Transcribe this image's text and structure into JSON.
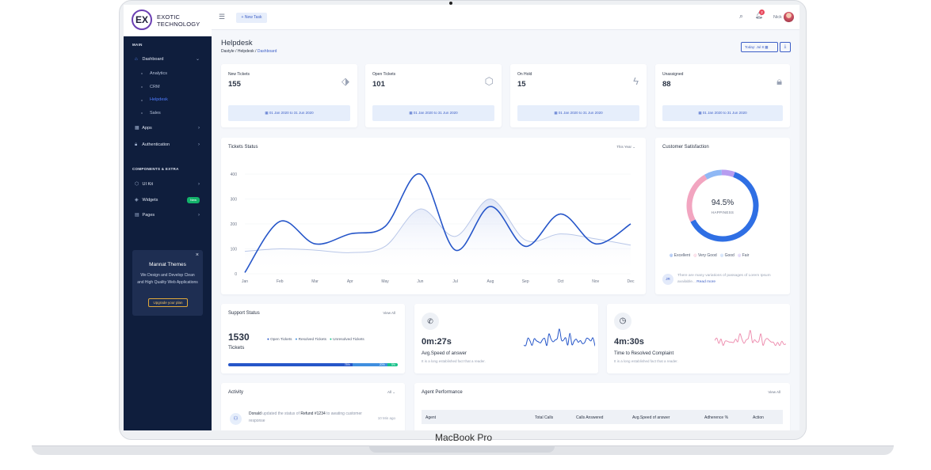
{
  "device": {
    "label": "MacBook Pro"
  },
  "brand": {
    "mark": "EX",
    "line1": "EXOTIC",
    "line2": "TECHNOLOGY"
  },
  "sidebar": {
    "main_heading": "MAIN",
    "dashboard": "Dashboard",
    "sub": [
      "Analytics",
      "CRM",
      "Helpdesk",
      "Sales"
    ],
    "apps": "Apps",
    "authentication": "Authentication",
    "components_heading": "COMPONENTS & EXTRA",
    "ui_kit": "UI Kit",
    "widgets": "Widgets",
    "widgets_badge": "New",
    "pages": "Pages",
    "promo": {
      "title": "Mannat Themes",
      "text": "We Design and Develop Clean and High Quality Web Applications",
      "button": "Upgrade your plan",
      "close": "×"
    }
  },
  "topbar": {
    "new_task": "+ New Task",
    "notification_count": "2",
    "user": "Nick"
  },
  "page": {
    "title": "Helpdesk",
    "breadcrumb": [
      "Dastyle",
      "Helpdesk",
      "Dashboard"
    ],
    "today": "Today: Jul 8"
  },
  "stats": [
    {
      "label": "New Tickets",
      "value": "155",
      "icon": "tag-icon",
      "range": "01 Jan 2020 to 31 Jun 2020"
    },
    {
      "label": "Open Tickets",
      "value": "101",
      "icon": "cube-icon",
      "range": "01 Jan 2020 to 31 Jun 2020"
    },
    {
      "label": "On Hold",
      "value": "15",
      "icon": "bolt-icon",
      "range": "01 Jan 2020 to 31 Jun 2020"
    },
    {
      "label": "Unassigned",
      "value": "88",
      "icon": "lock-icon",
      "range": "01 Jan 2020 to 31 Jun 2020"
    }
  ],
  "tickets_status": {
    "title": "Tickets Status",
    "period": "This Year"
  },
  "chart_data": {
    "type": "line",
    "categories": [
      "Jan",
      "Feb",
      "Mar",
      "Apr",
      "May",
      "Jun",
      "Jul",
      "Aug",
      "Sep",
      "Oct",
      "Nov",
      "Dec"
    ],
    "ylim": [
      0,
      400
    ],
    "yticks": [
      0,
      100,
      200,
      300,
      400
    ],
    "series": [
      {
        "values": [
          5,
          210,
          120,
          160,
          190,
          400,
          95,
          270,
          110,
          240,
          120,
          200
        ],
        "color": "#2656c9"
      },
      {
        "values": [
          90,
          100,
          95,
          85,
          110,
          260,
          150,
          300,
          135,
          160,
          140,
          115
        ],
        "color": "#b9c7e8"
      }
    ]
  },
  "satisfaction": {
    "title": "Customer Satisfaction",
    "value": "94.5%",
    "caption": "HAPPINESS",
    "ring": [
      {
        "name": "Excellent",
        "share": 0.62,
        "color": "#2f6fe4"
      },
      {
        "name": "Very Good",
        "share": 0.24,
        "color": "#f2a5c0"
      },
      {
        "name": "Good",
        "share": 0.08,
        "color": "#8fb8f5"
      },
      {
        "name": "Fair",
        "share": 0.06,
        "color": "#b79cf0"
      }
    ],
    "legend": [
      "Excellent",
      "Very Good",
      "Good",
      "Fair"
    ],
    "note_avatar": "JR",
    "note": "There are many variations of passages of Lorem Ipsum available...",
    "read_more": "Read more"
  },
  "support": {
    "title": "Support Status",
    "view_all": "View All",
    "count": "1530",
    "unit": "Tickets",
    "legend": [
      "Open Tickets",
      "Resolved Tickets",
      "Unresolved Tickets"
    ],
    "bar": [
      {
        "label": "75%",
        "share": 0.75,
        "color": "#2656c9"
      },
      {
        "label": "20%",
        "share": 0.2,
        "color": "#3f8fe0"
      },
      {
        "label": "5%",
        "share": 0.05,
        "color": "#19c28a"
      }
    ]
  },
  "speed": {
    "value": "0m:27s",
    "label": "Avg.Speed of answer",
    "sub": "It is a long established fact that a reader.",
    "color": "#2656c9"
  },
  "resolve": {
    "value": "4m:30s",
    "label": "Time to Resolved Complaint",
    "sub": "It is a long established fact that a reader.",
    "color": "#ee8fb0"
  },
  "activity": {
    "title": "Activity",
    "filter": "All",
    "item": {
      "who": "Donald",
      "text": "updated the status of",
      "link": "Refund #1234",
      "to": "to",
      "rest": "awating customer response",
      "time": "10 Min ago"
    }
  },
  "agent": {
    "title": "Agent Performance",
    "view_all": "View All",
    "columns": [
      "Agent",
      "Total Calls",
      "Calls Answered",
      "Avg.Speed of answer",
      "Adherence %",
      "Action"
    ]
  }
}
